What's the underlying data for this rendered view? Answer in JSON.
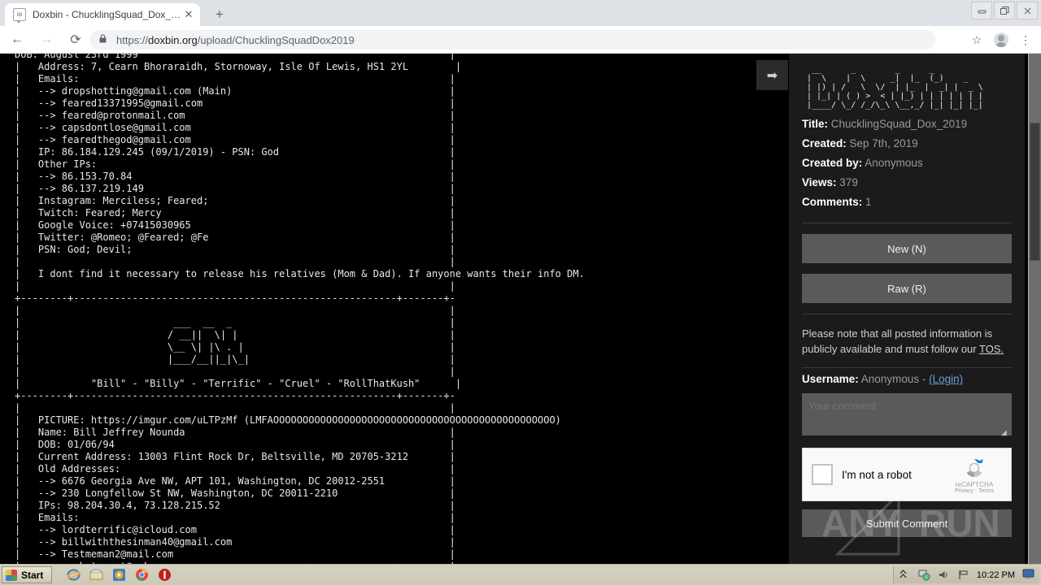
{
  "browser": {
    "tab": {
      "title": "Doxbin - ChucklingSquad_Dox_2019",
      "favicon": "io",
      "close": "✕"
    },
    "new_tab": "+",
    "window_controls": {
      "minimize": "–",
      "restore": "❐",
      "close": "✕"
    },
    "nav": {
      "back": "←",
      "forward": "→",
      "reload": "⟳"
    },
    "omnibox": {
      "lock": "🔒",
      "url_scheme": "https://",
      "url_host": "doxbin.org",
      "url_path": "/upload/ChucklingSquadDox2019"
    },
    "toolbar_right": {
      "bookmark": "☆",
      "menu": "⋮"
    }
  },
  "page": {
    "arrow_button": "➡",
    "dump_text": "DOB: August 23rd 1999                                                     |\n|   Address: 7, Cearn Bhoraraidh, Stornoway, Isle Of Lewis, HS1 2YL        |\n|   Emails:                                                               |\n|   --> dropshotting@gmail.com (Main)                                     |\n|   --> feared13371995@gmail.com                                          |\n|   --> feared@protonmail.com                                             |\n|   --> capsdontlose@gmail.com                                            |\n|   --> fearedthegod@gmail.com                                            |\n|   IP: 86.184.129.245 (09/1/2019) - PSN: God                             |\n|   Other IPs:                                                            |\n|   --> 86.153.70.84                                                      |\n|   --> 86.137.219.149                                                    |\n|   Instagram: Merciless; Feared;                                         |\n|   Twitch: Feared; Mercy                                                 |\n|   Google Voice: +07415030965                                            |\n|   Twitter: @Romeo; @Feared; @Fe                                         |\n|   PSN: God; Devil;                                                      |\n|                                                                         |\n|   I dont find it necessary to release his relatives (Mom & Dad). If anyone wants their info DM.\n|                                                                         |\n+--------+-------------------------------------------------------+-------+-\n|                                                                         |\n|                          ___  __  _                                     |\n|                         / __||  \\| |                                    |\n|                         \\__ \\| |\\ . |                                   |\n|                         |___/__||_|\\_|                                  |\n|                                                                         |\n|            \"Bill\" - \"Billy\" - \"Terrific\" - \"Cruel\" - \"RollThatKush\"      |\n+--------+-------------------------------------------------------+-------+-\n|                                                                         |\n|   PICTURE: https://imgur.com/uLTPzMf (LMFAOOOOOOOOOOOOOOOOOOOOOOOOOOOOOOOOOOOOOOOOOOOOOOOO)\n|   Name: Bill Jeffrey Nounda                                             |\n|   DOB: 01/06/94                                                         |\n|   Current Address: 13003 Flint Rock Dr, Beltsville, MD 20705-3212       |\n|   Old Addresses:                                                        |\n|   --> 6676 Georgia Ave NW, APT 101, Washington, DC 20012-2551           |\n|   --> 230 Longfellow St NW, Washington, DC 20011-2210                   |\n|   IPs: 98.204.30.4, 73.128.215.52                                       |\n|   Emails:                                                               |\n|   --> lordterrific@icloud.com                                           |\n|   --> billwiththesinman40@gmail.com                                     |\n|   --> Testmeman2@mail.com                                               |\n|   --> rockstarupt@yahoo.com                                             |"
  },
  "sidebar": {
    "logo_ascii": "  __      _        _      _\n |  \\    |  \\     _|  |_  (_)    _\n | |) | /   \\  \\/  | |_  |  _| |  _ \\\n | |_| | ( ) >  < | |_) | | | | | | |\n |____/ \\_/ /_/\\_\\ \\__,_/ |_| |_| |_|",
    "meta": [
      {
        "label": "Title:",
        "value": "ChucklingSquad_Dox_2019"
      },
      {
        "label": "Created:",
        "value": "Sep 7th, 2019"
      },
      {
        "label": "Created by:",
        "value": "Anonymous"
      },
      {
        "label": "Views:",
        "value": "379"
      },
      {
        "label": "Comments:",
        "value": "1"
      }
    ],
    "buttons": {
      "new": "New (N)",
      "raw": "Raw (R)"
    },
    "notice_text": "Please note that all posted information is publicly available and must follow our ",
    "notice_link": "TOS.",
    "username": {
      "label": "Username:",
      "value": "Anonymous",
      "separator": " - ",
      "login": "(Login)"
    },
    "comment": {
      "placeholder": "Your comment",
      "value": ""
    },
    "recaptcha": {
      "label": "I'm not a robot",
      "brand": "reCAPTCHA",
      "terms": "Privacy - Terms"
    },
    "submit": "Submit Comment"
  },
  "watermark": {
    "text": "ANY.RUN"
  },
  "taskbar": {
    "start": "Start",
    "quick_launch": [
      "internet-explorer-icon",
      "explorer-icon",
      "media-player-icon",
      "chrome-icon",
      "record-icon"
    ],
    "tray": {
      "time": "10:22 PM"
    }
  }
}
